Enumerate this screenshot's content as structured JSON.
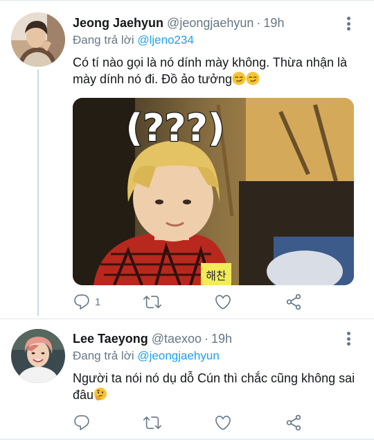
{
  "tweets": [
    {
      "name": "Jeong Jaehyun",
      "handle": "@jeongjaehyun",
      "separator": "·",
      "time": "19h",
      "reply_prefix": "Đang trả lời",
      "reply_to": "@ljeno234",
      "text": "Có tí nào gọi là nó dính mày không. Thừa nhận là mày dính nó đi. Đồ ảo tưởng",
      "emoji": [
        "smirking-face",
        "smirking-face"
      ],
      "media_caption": "(???)",
      "media_name_tag": "해찬",
      "reply_count": "1",
      "retweet_count": "",
      "like_count": ""
    },
    {
      "name": "Lee Taeyong",
      "handle": "@taexoo",
      "separator": "·",
      "time": "19h",
      "reply_prefix": "Đang trả lời",
      "reply_to": "@jeongjaehyun",
      "text": "Người ta nói nó dụ dỗ Cún thì chắc cũng không sai đâu",
      "emoji": [
        "thinking-face"
      ],
      "reply_count": "",
      "retweet_count": "",
      "like_count": ""
    }
  ],
  "icons": {
    "reply": "reply-icon",
    "retweet": "retweet-icon",
    "like": "like-icon",
    "share": "share-icon",
    "more": "more-options-icon"
  },
  "colors": {
    "text": "#14171a",
    "secondary": "#657786",
    "link": "#1da1f2",
    "thread_line": "#ccd6dd",
    "divider": "#e1e8ed"
  }
}
